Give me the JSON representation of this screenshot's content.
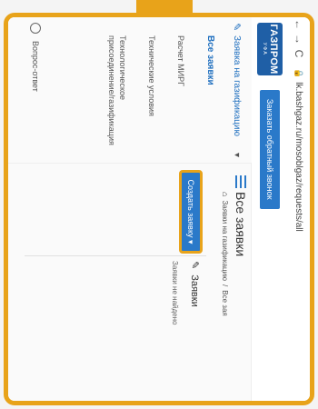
{
  "browser": {
    "back": "←",
    "forward": "→",
    "reload": "C",
    "url": "lk.bashgaz.ru/mosoblgaz/requests/all"
  },
  "header": {
    "logo_main": "ГАЗПРОМ",
    "logo_sub": "УФА",
    "callback_label": "Заказать обратный звонок"
  },
  "sidebar": {
    "section_label": "Заявка на газификацию",
    "active_item": "Все заявки",
    "items": [
      "Расчет МИРГ",
      "Технические условия",
      "Технологическое присоединение/газификация"
    ],
    "faq_label": "Вопрос-ответ"
  },
  "main": {
    "title": "Все заявки",
    "breadcrumb": [
      "Заявки на газификацию",
      "/",
      "Все зая"
    ],
    "create_button": "Создать заявку ▾",
    "requests_label": "Заявки",
    "empty_text": "Заявки не найдено"
  },
  "colors": {
    "accent": "#2a79c9",
    "frame": "#e8a31a",
    "logo": "#1f5fa6"
  }
}
